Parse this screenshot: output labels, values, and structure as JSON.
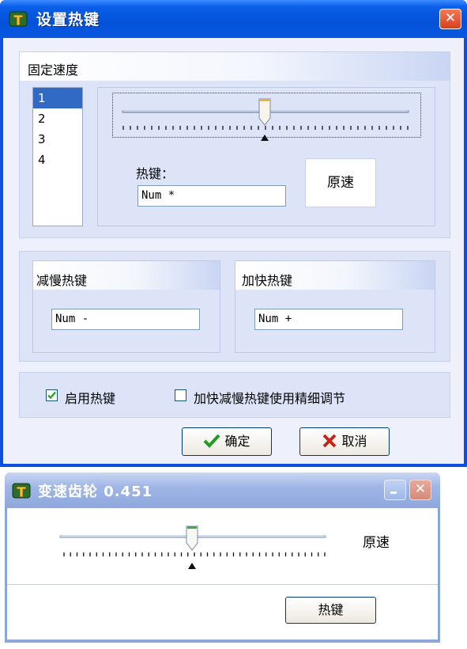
{
  "dialog": {
    "title": "设置热键",
    "close_glyph": "✕",
    "fixed_speed": {
      "title": "固定速度",
      "speeds": [
        "1",
        "2",
        "3",
        "4"
      ],
      "selected_index": 0,
      "slider_fraction": 0.5,
      "hotkey_label": "热键：",
      "hotkey_value": "Num *",
      "original_speed_button": "原速"
    },
    "slow_down": {
      "title": "减慢热键",
      "value": "Num -"
    },
    "speed_up": {
      "title": "加快热键",
      "value": "Num +"
    },
    "enable_hotkeys": {
      "label": "启用热键",
      "checked": true
    },
    "fine_adjust": {
      "label": "加快减慢热键使用精细调节",
      "checked": false
    },
    "ok_button": "确定",
    "cancel_button": "取消"
  },
  "gear_window": {
    "title": "变速齿轮 0.451",
    "slider_fraction": 0.5,
    "original_speed_label": "原速",
    "hotkey_button": "热键"
  },
  "colors": {
    "titlebar": "#0a52dc",
    "client": "#eef1fb",
    "panel": "#dde4f7",
    "selection": "#316ac5",
    "close_red": "#d8401c"
  }
}
